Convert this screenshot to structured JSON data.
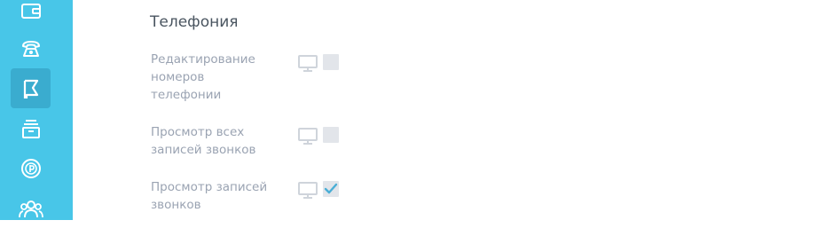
{
  "sidebar": {
    "items": [
      {
        "icon": "wallet-icon",
        "active": false
      },
      {
        "icon": "phone-icon",
        "active": false
      },
      {
        "icon": "flag-icon",
        "active": true
      },
      {
        "icon": "archive-icon",
        "active": false
      },
      {
        "icon": "money-icon",
        "active": false
      },
      {
        "icon": "users-icon",
        "active": false
      }
    ],
    "colors": {
      "background": "#48c6e8",
      "active": "#3aaccf"
    }
  },
  "section": {
    "title": "Телефония",
    "permissions": [
      {
        "label": "Редактирование номеров телефонии",
        "checked": false
      },
      {
        "label": "Просмотр всех записей звонков",
        "checked": false
      },
      {
        "label": "Просмотр записей звонков",
        "checked": true
      }
    ]
  },
  "colors": {
    "label": "#9aa3b2",
    "title": "#4a5560",
    "check": "#4aaed6"
  }
}
